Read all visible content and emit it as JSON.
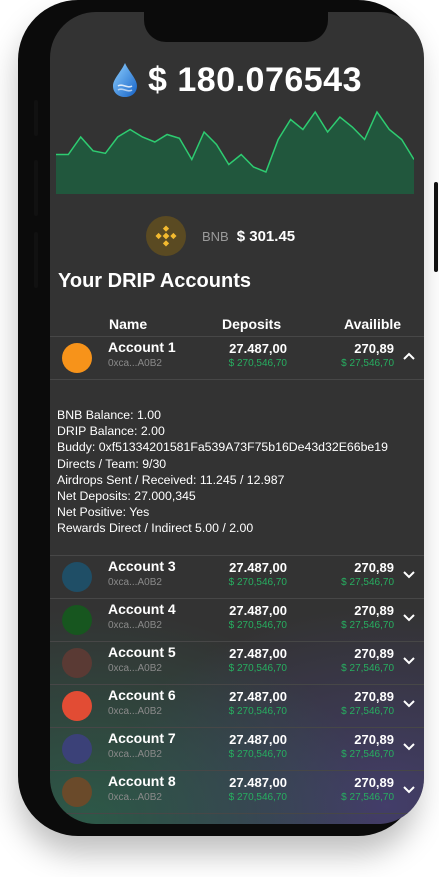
{
  "header": {
    "balance": "$ 180.076543",
    "token_name": "BNB",
    "token_price": "$ 301.45",
    "chart_points": [
      34,
      34,
      20,
      31,
      33,
      20,
      14,
      20,
      24,
      18,
      21,
      38,
      16,
      26,
      42,
      34,
      44,
      48,
      22,
      6,
      14,
      0,
      16,
      4,
      12,
      22,
      0,
      14,
      22,
      38
    ]
  },
  "accounts_section": {
    "title": "Your DRIP Accounts",
    "col_name": "Name",
    "col_deposits": "Deposits",
    "col_available": "Availible"
  },
  "accounts": [
    {
      "name": "Account 1",
      "addr": "0xca...A0B2",
      "deposits": "27.487,00",
      "deposits_sub": "$ 270,546,70",
      "available": "270,89",
      "available_sub": "$ 27,546,70",
      "color": "#f7931a",
      "expanded": true
    },
    {
      "name": "Account 3",
      "addr": "0xca...A0B2",
      "deposits": "27.487,00",
      "deposits_sub": "$ 270,546,70",
      "available": "270,89",
      "available_sub": "$ 27,546,70",
      "color": "#1f4e66",
      "expanded": false
    },
    {
      "name": "Account 4",
      "addr": "0xca...A0B2",
      "deposits": "27.487,00",
      "deposits_sub": "$ 270,546,70",
      "available": "270,89",
      "available_sub": "$ 27,546,70",
      "color": "#17561f",
      "expanded": false
    },
    {
      "name": "Account 5",
      "addr": "0xca...A0B2",
      "deposits": "27.487,00",
      "deposits_sub": "$ 270,546,70",
      "available": "270,89",
      "available_sub": "$ 27,546,70",
      "color": "#5a3a34",
      "expanded": false
    },
    {
      "name": "Account 6",
      "addr": "0xca...A0B2",
      "deposits": "27.487,00",
      "deposits_sub": "$ 270,546,70",
      "available": "270,89",
      "available_sub": "$ 27,546,70",
      "color": "#e24c34",
      "expanded": false
    },
    {
      "name": "Account 7",
      "addr": "0xca...A0B2",
      "deposits": "27.487,00",
      "deposits_sub": "$ 270,546,70",
      "available": "270,89",
      "available_sub": "$ 27,546,70",
      "color": "#3b4178",
      "expanded": false
    },
    {
      "name": "Account 8",
      "addr": "0xca...A0B2",
      "deposits": "27.487,00",
      "deposits_sub": "$ 270,546,70",
      "available": "270,89",
      "available_sub": "$ 27,546,70",
      "color": "#6a4a2a",
      "expanded": false
    }
  ],
  "details": [
    "BNB Balance: 1.00",
    "DRIP Balance: 2.00",
    "Buddy: 0xf51334201581Fa539A73F75b16De43d32E66be19",
    "Directs / Team: 9/30",
    "Airdrops Sent / Received: 11.245 / 12.987",
    "Net Deposits: 27.000,345",
    "Net Positive: Yes",
    "Rewards Direct / Indirect 5.00 / 2.00"
  ],
  "icons": {
    "drip": "water-drop-icon",
    "token": "bnb-icon",
    "expand": "chevron-down-icon",
    "collapse": "chevron-up-icon"
  },
  "colors": {
    "background": "#333333",
    "positive": "#27ae60",
    "chart_line": "#2ecc71",
    "chart_fill": "#1f5e40"
  }
}
